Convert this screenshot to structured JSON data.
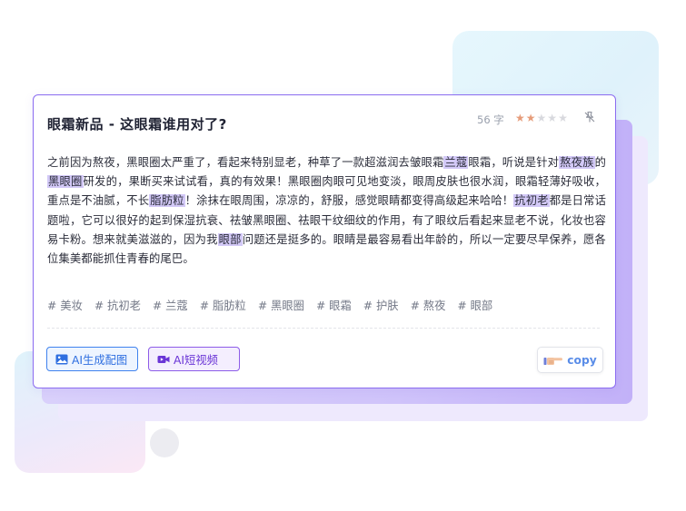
{
  "card": {
    "title": "眼霜新品 - 这眼霜谁用对了?",
    "char_count": "56 字",
    "rating": {
      "filled": 2,
      "total": 5
    },
    "star_colors": {
      "on": "#e69c7a",
      "off": "#d8d9de"
    },
    "pin_icon": "pin-off-icon"
  },
  "body_segments": [
    {
      "text": "之前因为熬夜，黑眼圈太严重了，看起来特别显老，种草了一款超滋润去皱眼霜",
      "hl": false
    },
    {
      "text": "兰蔻",
      "hl": true
    },
    {
      "text": "眼霜，听说是针对",
      "hl": false
    },
    {
      "text": "熬夜族",
      "hl": true
    },
    {
      "text": "的",
      "hl": false
    },
    {
      "text": "黑眼圈",
      "hl": true
    },
    {
      "text": "研发的，果断买来试试看，真的有效果！黑眼圈肉眼可见地变淡，眼周皮肤也很水润，眼霜轻薄好吸收，重点是不油腻，不长",
      "hl": false
    },
    {
      "text": "脂肪粒",
      "hl": true
    },
    {
      "text": "！涂抹在眼周围，凉凉的，舒服，感觉眼睛都变得高级起来哈哈！",
      "hl": false
    },
    {
      "text": "抗初老",
      "hl": true
    },
    {
      "text": "都是日常话题啦，它可以很好的起到保湿抗衰、祛皱黑眼圈、祛眼干纹细纹的作用，有了眼纹后看起来显老不说，化妆也容易卡粉。想来就美滋滋的，因为我",
      "hl": false
    },
    {
      "text": "眼部",
      "hl": true
    },
    {
      "text": "问题还是挺多的。眼睛是最容易看出年龄的，所以一定要尽早保养，愿各位集美都能抓住青春的尾巴。",
      "hl": false
    }
  ],
  "tags": [
    "# 美妆",
    "# 抗初老",
    "# 兰蔻",
    "# 脂肪粒",
    "# 黑眼圈",
    "# 眼霜",
    "# 护肤",
    "# 熬夜",
    "# 眼部"
  ],
  "actions": {
    "image_label": "AI生成配图",
    "image_icon": "image-icon",
    "video_label": "AI短视频",
    "video_icon": "video-icon",
    "copy_label": "copy",
    "copy_icon": "hand-pointer-icon"
  },
  "colors": {
    "accent": "#8b6cf0",
    "highlight": "#d3c9f7",
    "image_btn": "#3f82ee",
    "video_btn": "#8d5ce8",
    "copy_text": "#5a8de8"
  }
}
